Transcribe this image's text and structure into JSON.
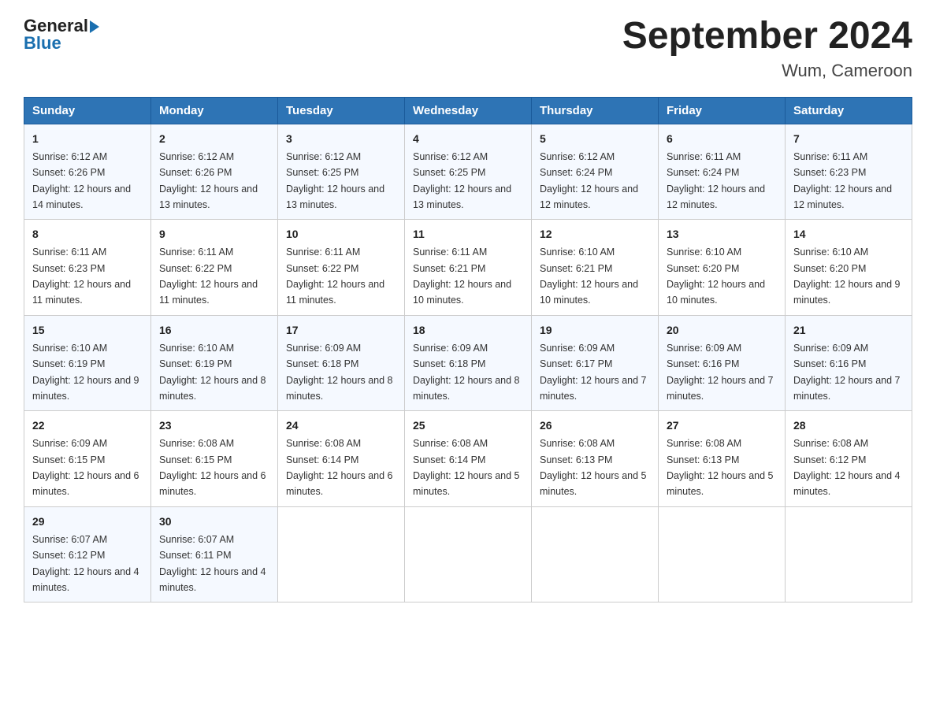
{
  "header": {
    "logo_general": "General",
    "logo_blue": "Blue",
    "title": "September 2024",
    "subtitle": "Wum, Cameroon"
  },
  "weekdays": [
    "Sunday",
    "Monday",
    "Tuesday",
    "Wednesday",
    "Thursday",
    "Friday",
    "Saturday"
  ],
  "weeks": [
    [
      {
        "day": "1",
        "sunrise": "6:12 AM",
        "sunset": "6:26 PM",
        "daylight": "12 hours and 14 minutes."
      },
      {
        "day": "2",
        "sunrise": "6:12 AM",
        "sunset": "6:26 PM",
        "daylight": "12 hours and 13 minutes."
      },
      {
        "day": "3",
        "sunrise": "6:12 AM",
        "sunset": "6:25 PM",
        "daylight": "12 hours and 13 minutes."
      },
      {
        "day": "4",
        "sunrise": "6:12 AM",
        "sunset": "6:25 PM",
        "daylight": "12 hours and 13 minutes."
      },
      {
        "day": "5",
        "sunrise": "6:12 AM",
        "sunset": "6:24 PM",
        "daylight": "12 hours and 12 minutes."
      },
      {
        "day": "6",
        "sunrise": "6:11 AM",
        "sunset": "6:24 PM",
        "daylight": "12 hours and 12 minutes."
      },
      {
        "day": "7",
        "sunrise": "6:11 AM",
        "sunset": "6:23 PM",
        "daylight": "12 hours and 12 minutes."
      }
    ],
    [
      {
        "day": "8",
        "sunrise": "6:11 AM",
        "sunset": "6:23 PM",
        "daylight": "12 hours and 11 minutes."
      },
      {
        "day": "9",
        "sunrise": "6:11 AM",
        "sunset": "6:22 PM",
        "daylight": "12 hours and 11 minutes."
      },
      {
        "day": "10",
        "sunrise": "6:11 AM",
        "sunset": "6:22 PM",
        "daylight": "12 hours and 11 minutes."
      },
      {
        "day": "11",
        "sunrise": "6:11 AM",
        "sunset": "6:21 PM",
        "daylight": "12 hours and 10 minutes."
      },
      {
        "day": "12",
        "sunrise": "6:10 AM",
        "sunset": "6:21 PM",
        "daylight": "12 hours and 10 minutes."
      },
      {
        "day": "13",
        "sunrise": "6:10 AM",
        "sunset": "6:20 PM",
        "daylight": "12 hours and 10 minutes."
      },
      {
        "day": "14",
        "sunrise": "6:10 AM",
        "sunset": "6:20 PM",
        "daylight": "12 hours and 9 minutes."
      }
    ],
    [
      {
        "day": "15",
        "sunrise": "6:10 AM",
        "sunset": "6:19 PM",
        "daylight": "12 hours and 9 minutes."
      },
      {
        "day": "16",
        "sunrise": "6:10 AM",
        "sunset": "6:19 PM",
        "daylight": "12 hours and 8 minutes."
      },
      {
        "day": "17",
        "sunrise": "6:09 AM",
        "sunset": "6:18 PM",
        "daylight": "12 hours and 8 minutes."
      },
      {
        "day": "18",
        "sunrise": "6:09 AM",
        "sunset": "6:18 PM",
        "daylight": "12 hours and 8 minutes."
      },
      {
        "day": "19",
        "sunrise": "6:09 AM",
        "sunset": "6:17 PM",
        "daylight": "12 hours and 7 minutes."
      },
      {
        "day": "20",
        "sunrise": "6:09 AM",
        "sunset": "6:16 PM",
        "daylight": "12 hours and 7 minutes."
      },
      {
        "day": "21",
        "sunrise": "6:09 AM",
        "sunset": "6:16 PM",
        "daylight": "12 hours and 7 minutes."
      }
    ],
    [
      {
        "day": "22",
        "sunrise": "6:09 AM",
        "sunset": "6:15 PM",
        "daylight": "12 hours and 6 minutes."
      },
      {
        "day": "23",
        "sunrise": "6:08 AM",
        "sunset": "6:15 PM",
        "daylight": "12 hours and 6 minutes."
      },
      {
        "day": "24",
        "sunrise": "6:08 AM",
        "sunset": "6:14 PM",
        "daylight": "12 hours and 6 minutes."
      },
      {
        "day": "25",
        "sunrise": "6:08 AM",
        "sunset": "6:14 PM",
        "daylight": "12 hours and 5 minutes."
      },
      {
        "day": "26",
        "sunrise": "6:08 AM",
        "sunset": "6:13 PM",
        "daylight": "12 hours and 5 minutes."
      },
      {
        "day": "27",
        "sunrise": "6:08 AM",
        "sunset": "6:13 PM",
        "daylight": "12 hours and 5 minutes."
      },
      {
        "day": "28",
        "sunrise": "6:08 AM",
        "sunset": "6:12 PM",
        "daylight": "12 hours and 4 minutes."
      }
    ],
    [
      {
        "day": "29",
        "sunrise": "6:07 AM",
        "sunset": "6:12 PM",
        "daylight": "12 hours and 4 minutes."
      },
      {
        "day": "30",
        "sunrise": "6:07 AM",
        "sunset": "6:11 PM",
        "daylight": "12 hours and 4 minutes."
      },
      null,
      null,
      null,
      null,
      null
    ]
  ]
}
